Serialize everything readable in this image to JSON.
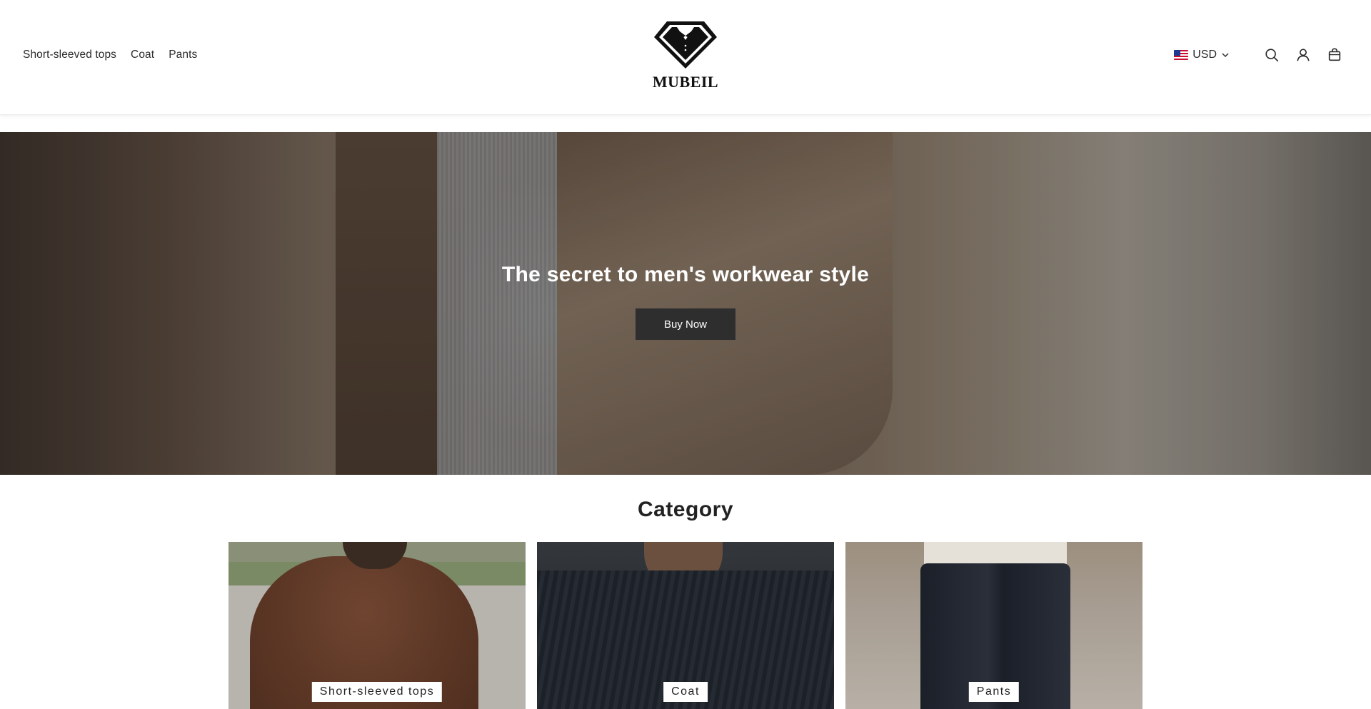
{
  "nav": {
    "items": [
      {
        "label": "Short-sleeved tops"
      },
      {
        "label": "Coat"
      },
      {
        "label": "Pants"
      }
    ]
  },
  "brand": {
    "name": "MUBEIL"
  },
  "tools": {
    "currency": "USD",
    "icons": [
      "search-icon",
      "account-icon",
      "cart-icon"
    ]
  },
  "hero": {
    "title": "The secret to men's workwear style",
    "button_label": "Buy Now"
  },
  "category": {
    "title": "Category",
    "cards": [
      {
        "label": "Short-sleeved tops"
      },
      {
        "label": "Coat"
      },
      {
        "label": "Pants"
      }
    ]
  },
  "colors": {
    "button_bg": "#2e2e2e",
    "text": "#222222"
  }
}
